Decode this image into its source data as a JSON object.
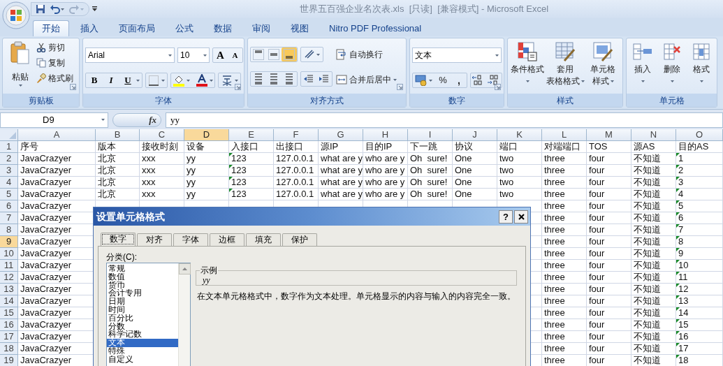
{
  "title_bar": {
    "title": "世界五百强企业名次表.xls  [只读]  [兼容模式] - Microsoft Excel"
  },
  "ribbon_tabs": [
    {
      "label": "开始",
      "selected": true
    },
    {
      "label": "插入",
      "selected": false
    },
    {
      "label": "页面布局",
      "selected": false
    },
    {
      "label": "公式",
      "selected": false
    },
    {
      "label": "数据",
      "selected": false
    },
    {
      "label": "审阅",
      "selected": false
    },
    {
      "label": "视图",
      "selected": false
    },
    {
      "label": "Nitro PDF Professional",
      "selected": false
    }
  ],
  "ribbon": {
    "clipboard": {
      "label": "剪贴板",
      "paste": "粘贴",
      "commands": [
        "剪切",
        "复制",
        "格式刷"
      ]
    },
    "font": {
      "label": "字体",
      "font_name": "Arial",
      "font_size": "10",
      "grow": "A",
      "shrink": "A",
      "styles": [
        "B",
        "I",
        "U"
      ]
    },
    "alignment": {
      "label": "对齐方式",
      "vertical": [
        {
          "selected": false
        },
        {
          "selected": false
        },
        {
          "selected": true
        }
      ],
      "wrap_text": "自动换行",
      "merge_center": "合并后居中"
    },
    "number": {
      "label": "数字",
      "format": "文本",
      "percent": "%",
      "comma": ","
    },
    "styles": {
      "label": "样式",
      "buttons": [
        {
          "lines": [
            "条件格式"
          ]
        },
        {
          "lines": [
            "套用",
            "表格格式"
          ]
        },
        {
          "lines": [
            "单元格",
            "样式"
          ]
        }
      ]
    },
    "cells": {
      "label": "单元格",
      "buttons": [
        "插入",
        "删除",
        "格式"
      ]
    }
  },
  "formula_bar": {
    "name_box": "D9",
    "function_label": "fx",
    "value": "yy"
  },
  "sheet": {
    "columns": [
      {
        "label": "A",
        "selected": false
      },
      {
        "label": "B",
        "selected": false
      },
      {
        "label": "C",
        "selected": false
      },
      {
        "label": "D",
        "selected": true
      },
      {
        "label": "E",
        "selected": false
      },
      {
        "label": "F",
        "selected": false
      },
      {
        "label": "G",
        "selected": false
      },
      {
        "label": "H",
        "selected": false
      },
      {
        "label": "I",
        "selected": false
      },
      {
        "label": "J",
        "selected": false
      },
      {
        "label": "K",
        "selected": false
      },
      {
        "label": "L",
        "selected": false
      },
      {
        "label": "M",
        "selected": false
      },
      {
        "label": "N",
        "selected": false
      },
      {
        "label": "O",
        "selected": false
      }
    ],
    "rows": [
      {
        "number": "1",
        "selected": false,
        "cells": [
          {
            "text": "序号",
            "flagged": false
          },
          {
            "text": "版本",
            "flagged": false
          },
          {
            "text": "接收时刻",
            "flagged": false
          },
          {
            "text": "设备",
            "flagged": false
          },
          {
            "text": "入接口",
            "flagged": false
          },
          {
            "text": "出接口",
            "flagged": false
          },
          {
            "text": "源IP",
            "flagged": false
          },
          {
            "text": "目的IP",
            "flagged": false
          },
          {
            "text": "下一跳",
            "flagged": false
          },
          {
            "text": "协议",
            "flagged": false
          },
          {
            "text": "端口",
            "flagged": false
          },
          {
            "text": "对端端口",
            "flagged": false
          },
          {
            "text": "TOS",
            "flagged": false
          },
          {
            "text": "源AS",
            "flagged": false
          },
          {
            "text": "目的AS",
            "flagged": false
          }
        ]
      },
      {
        "number": "2",
        "selected": false,
        "cells": [
          {
            "text": "JavaCrazyer",
            "flagged": false
          },
          {
            "text": "北京",
            "flagged": false
          },
          {
            "text": "xxx",
            "flagged": false
          },
          {
            "text": "yy",
            "flagged": false
          },
          {
            "text": "123",
            "flagged": true
          },
          {
            "text": "127.0.0.1",
            "flagged": false
          },
          {
            "text": "what are y",
            "flagged": false
          },
          {
            "text": "who are y",
            "flagged": false
          },
          {
            "text": "Oh  sure!",
            "flagged": false
          },
          {
            "text": "One",
            "flagged": false
          },
          {
            "text": "two",
            "flagged": false
          },
          {
            "text": "three",
            "flagged": false
          },
          {
            "text": "four",
            "flagged": false
          },
          {
            "text": "不知道",
            "flagged": false
          },
          {
            "text": "1",
            "flagged": true
          }
        ]
      },
      {
        "number": "3",
        "selected": false,
        "cells": [
          {
            "text": "JavaCrazyer",
            "flagged": false
          },
          {
            "text": "北京",
            "flagged": false
          },
          {
            "text": "xxx",
            "flagged": false
          },
          {
            "text": "yy",
            "flagged": false
          },
          {
            "text": "123",
            "flagged": true
          },
          {
            "text": "127.0.0.1",
            "flagged": false
          },
          {
            "text": "what are y",
            "flagged": false
          },
          {
            "text": "who are y",
            "flagged": false
          },
          {
            "text": "Oh  sure!",
            "flagged": false
          },
          {
            "text": "One",
            "flagged": false
          },
          {
            "text": "two",
            "flagged": false
          },
          {
            "text": "three",
            "flagged": false
          },
          {
            "text": "four",
            "flagged": false
          },
          {
            "text": "不知道",
            "flagged": false
          },
          {
            "text": "2",
            "flagged": true
          }
        ]
      },
      {
        "number": "4",
        "selected": false,
        "cells": [
          {
            "text": "JavaCrazyer",
            "flagged": false
          },
          {
            "text": "北京",
            "flagged": false
          },
          {
            "text": "xxx",
            "flagged": false
          },
          {
            "text": "yy",
            "flagged": false
          },
          {
            "text": "123",
            "flagged": true
          },
          {
            "text": "127.0.0.1",
            "flagged": false
          },
          {
            "text": "what are y",
            "flagged": false
          },
          {
            "text": "who are y",
            "flagged": false
          },
          {
            "text": "Oh  sure!",
            "flagged": false
          },
          {
            "text": "One",
            "flagged": false
          },
          {
            "text": "two",
            "flagged": false
          },
          {
            "text": "three",
            "flagged": false
          },
          {
            "text": "four",
            "flagged": false
          },
          {
            "text": "不知道",
            "flagged": false
          },
          {
            "text": "3",
            "flagged": true
          }
        ]
      },
      {
        "number": "5",
        "selected": false,
        "cells": [
          {
            "text": "JavaCrazyer",
            "flagged": false
          },
          {
            "text": "北京",
            "flagged": false
          },
          {
            "text": "xxx",
            "flagged": false
          },
          {
            "text": "yy",
            "flagged": false
          },
          {
            "text": "123",
            "flagged": true
          },
          {
            "text": "127.0.0.1",
            "flagged": false
          },
          {
            "text": "what are y",
            "flagged": false
          },
          {
            "text": "who are y",
            "flagged": false
          },
          {
            "text": "Oh  sure!",
            "flagged": false
          },
          {
            "text": "One",
            "flagged": false
          },
          {
            "text": "two",
            "flagged": false
          },
          {
            "text": "three",
            "flagged": false
          },
          {
            "text": "four",
            "flagged": false
          },
          {
            "text": "不知道",
            "flagged": false
          },
          {
            "text": "4",
            "flagged": true
          }
        ]
      },
      {
        "number": "6",
        "selected": false,
        "cells": [
          {
            "text": "JavaCrazyer",
            "flagged": false
          },
          null,
          null,
          null,
          null,
          null,
          null,
          null,
          null,
          null,
          null,
          {
            "text": "three",
            "flagged": false
          },
          {
            "text": "four",
            "flagged": false
          },
          {
            "text": "不知道",
            "flagged": false
          },
          {
            "text": "5",
            "flagged": true
          }
        ]
      },
      {
        "number": "7",
        "selected": false,
        "cells": [
          {
            "text": "JavaCrazyer",
            "flagged": false
          },
          null,
          null,
          null,
          null,
          null,
          null,
          null,
          null,
          null,
          null,
          {
            "text": "three",
            "flagged": false
          },
          {
            "text": "four",
            "flagged": false
          },
          {
            "text": "不知道",
            "flagged": false
          },
          {
            "text": "6",
            "flagged": true
          }
        ]
      },
      {
        "number": "8",
        "selected": false,
        "cells": [
          {
            "text": "JavaCrazyer",
            "flagged": false
          },
          null,
          null,
          null,
          null,
          null,
          null,
          null,
          null,
          null,
          null,
          {
            "text": "three",
            "flagged": false
          },
          {
            "text": "four",
            "flagged": false
          },
          {
            "text": "不知道",
            "flagged": false
          },
          {
            "text": "7",
            "flagged": true
          }
        ]
      },
      {
        "number": "9",
        "selected": true,
        "cells": [
          {
            "text": "JavaCrazyer",
            "flagged": false
          },
          null,
          null,
          null,
          null,
          null,
          null,
          null,
          null,
          null,
          null,
          {
            "text": "three",
            "flagged": false
          },
          {
            "text": "four",
            "flagged": false
          },
          {
            "text": "不知道",
            "flagged": false
          },
          {
            "text": "8",
            "flagged": true
          }
        ]
      },
      {
        "number": "10",
        "selected": false,
        "cells": [
          {
            "text": "JavaCrazyer",
            "flagged": false
          },
          null,
          null,
          null,
          null,
          null,
          null,
          null,
          null,
          null,
          null,
          {
            "text": "three",
            "flagged": false
          },
          {
            "text": "four",
            "flagged": false
          },
          {
            "text": "不知道",
            "flagged": false
          },
          {
            "text": "9",
            "flagged": true
          }
        ]
      },
      {
        "number": "11",
        "selected": false,
        "cells": [
          {
            "text": "JavaCrazyer",
            "flagged": false
          },
          null,
          null,
          null,
          null,
          null,
          null,
          null,
          null,
          null,
          null,
          {
            "text": "three",
            "flagged": false
          },
          {
            "text": "four",
            "flagged": false
          },
          {
            "text": "不知道",
            "flagged": false
          },
          {
            "text": "10",
            "flagged": true
          }
        ]
      },
      {
        "number": "12",
        "selected": false,
        "cells": [
          {
            "text": "JavaCrazyer",
            "flagged": false
          },
          null,
          null,
          null,
          null,
          null,
          null,
          null,
          null,
          null,
          null,
          {
            "text": "three",
            "flagged": false
          },
          {
            "text": "four",
            "flagged": false
          },
          {
            "text": "不知道",
            "flagged": false
          },
          {
            "text": "11",
            "flagged": true
          }
        ]
      },
      {
        "number": "13",
        "selected": false,
        "cells": [
          {
            "text": "JavaCrazyer",
            "flagged": false
          },
          null,
          null,
          null,
          null,
          null,
          null,
          null,
          null,
          null,
          null,
          {
            "text": "three",
            "flagged": false
          },
          {
            "text": "four",
            "flagged": false
          },
          {
            "text": "不知道",
            "flagged": false
          },
          {
            "text": "12",
            "flagged": true
          }
        ]
      },
      {
        "number": "14",
        "selected": false,
        "cells": [
          {
            "text": "JavaCrazyer",
            "flagged": false
          },
          null,
          null,
          null,
          null,
          null,
          null,
          null,
          null,
          null,
          null,
          {
            "text": "three",
            "flagged": false
          },
          {
            "text": "four",
            "flagged": false
          },
          {
            "text": "不知道",
            "flagged": false
          },
          {
            "text": "13",
            "flagged": true
          }
        ]
      },
      {
        "number": "15",
        "selected": false,
        "cells": [
          {
            "text": "JavaCrazyer",
            "flagged": false
          },
          null,
          null,
          null,
          null,
          null,
          null,
          null,
          null,
          null,
          null,
          {
            "text": "three",
            "flagged": false
          },
          {
            "text": "four",
            "flagged": false
          },
          {
            "text": "不知道",
            "flagged": false
          },
          {
            "text": "14",
            "flagged": true
          }
        ]
      },
      {
        "number": "16",
        "selected": false,
        "cells": [
          {
            "text": "JavaCrazyer",
            "flagged": false
          },
          null,
          null,
          null,
          null,
          null,
          null,
          null,
          null,
          null,
          null,
          {
            "text": "three",
            "flagged": false
          },
          {
            "text": "four",
            "flagged": false
          },
          {
            "text": "不知道",
            "flagged": false
          },
          {
            "text": "15",
            "flagged": true
          }
        ]
      },
      {
        "number": "17",
        "selected": false,
        "cells": [
          {
            "text": "JavaCrazyer",
            "flagged": false
          },
          null,
          null,
          null,
          null,
          null,
          null,
          null,
          null,
          null,
          null,
          {
            "text": "three",
            "flagged": false
          },
          {
            "text": "four",
            "flagged": false
          },
          {
            "text": "不知道",
            "flagged": false
          },
          {
            "text": "16",
            "flagged": true
          }
        ]
      },
      {
        "number": "18",
        "selected": false,
        "cells": [
          {
            "text": "JavaCrazyer",
            "flagged": false
          },
          null,
          null,
          null,
          null,
          null,
          null,
          null,
          null,
          null,
          null,
          {
            "text": "three",
            "flagged": false
          },
          {
            "text": "four",
            "flagged": false
          },
          {
            "text": "不知道",
            "flagged": false
          },
          {
            "text": "17",
            "flagged": true
          }
        ]
      },
      {
        "number": "19",
        "selected": false,
        "cells": [
          {
            "text": "JavaCrazyer",
            "flagged": false
          },
          null,
          null,
          null,
          null,
          null,
          null,
          null,
          null,
          null,
          null,
          {
            "text": "three",
            "flagged": false
          },
          {
            "text": "four",
            "flagged": false
          },
          {
            "text": "不知道",
            "flagged": false
          },
          {
            "text": "18",
            "flagged": true
          }
        ]
      }
    ]
  },
  "dialog": {
    "title": "设置单元格格式",
    "help": "?",
    "tabs": [
      {
        "label": "数字",
        "selected": true
      },
      {
        "label": "对齐",
        "selected": false
      },
      {
        "label": "字体",
        "selected": false
      },
      {
        "label": "边框",
        "selected": false
      },
      {
        "label": "填充",
        "selected": false
      },
      {
        "label": "保护",
        "selected": false
      }
    ],
    "category_label": "分类(C):",
    "categories": [
      {
        "label": "常规",
        "selected": false
      },
      {
        "label": "数值",
        "selected": false
      },
      {
        "label": "货币",
        "selected": false
      },
      {
        "label": "会计专用",
        "selected": false
      },
      {
        "label": "日期",
        "selected": false
      },
      {
        "label": "时间",
        "selected": false
      },
      {
        "label": "百分比",
        "selected": false
      },
      {
        "label": "分数",
        "selected": false
      },
      {
        "label": "科学记数",
        "selected": false
      },
      {
        "label": "文本",
        "selected": true
      },
      {
        "label": "特殊",
        "selected": false
      },
      {
        "label": "自定义",
        "selected": false
      }
    ],
    "sample_label": "示例",
    "sample_value": "yy",
    "description": "在文本单元格格式中，数字作为文本处理。单元格显示的内容与输入的内容完全一致。"
  }
}
